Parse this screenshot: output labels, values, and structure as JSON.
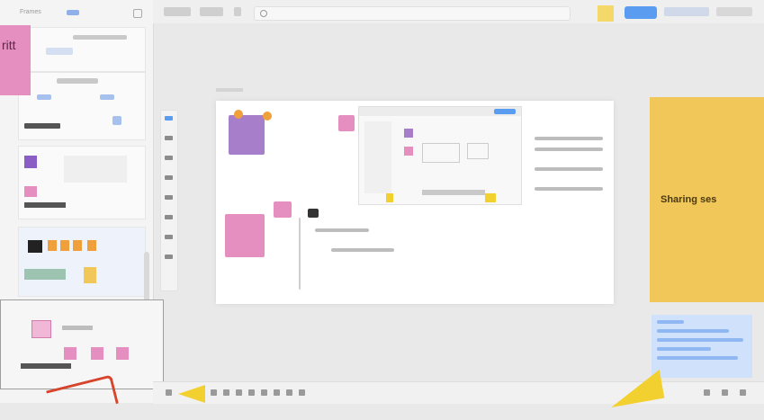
{
  "left_panel": {
    "header_label": "Frames",
    "sticky_text": "ritt",
    "thumbnail_count": 6
  },
  "board": {
    "right_sticky_text": "Sharing ses"
  },
  "colors": {
    "sticky_pink": "#e48fc0",
    "sticky_purple": "#a77ec9",
    "sticky_yellow": "#f1c75a",
    "accent_blue": "#5a9cf0",
    "annotation_yellow": "#f2d030",
    "annotation_red": "#d9452c"
  },
  "icons": [
    "search-icon",
    "share-icon",
    "zoom-icon",
    "cursor-icon",
    "pen-icon",
    "sticky-note-icon"
  ]
}
